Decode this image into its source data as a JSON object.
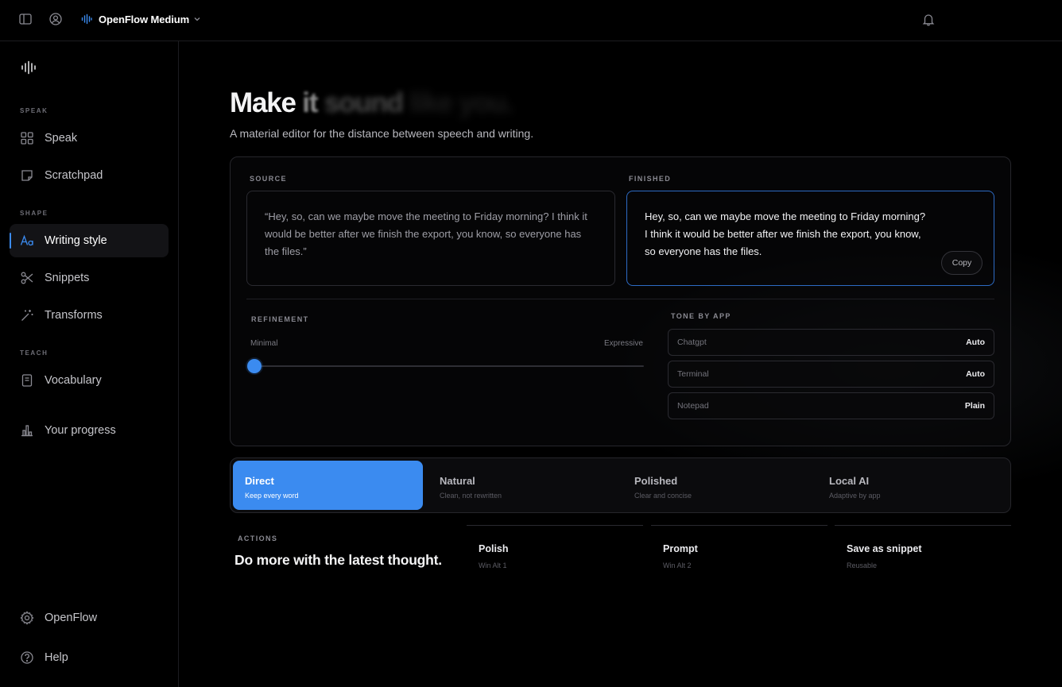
{
  "topbar": {
    "model_name": "OpenFlow Medium"
  },
  "sidebar": {
    "sections": {
      "speak": "SPEAK",
      "shape": "SHAPE",
      "teach": "TEACH"
    },
    "items": [
      {
        "label": "Speak",
        "icon": "grid-icon"
      },
      {
        "label": "Scratchpad",
        "icon": "note-icon"
      },
      {
        "label": "Writing style",
        "icon": "text-style-icon",
        "active": true
      },
      {
        "label": "Snippets",
        "icon": "scissors-icon"
      },
      {
        "label": "Transforms",
        "icon": "magic-wand-icon"
      },
      {
        "label": "Vocabulary",
        "icon": "book-icon"
      },
      {
        "label": "Your progress",
        "icon": "bar-chart-icon"
      }
    ],
    "footer": [
      {
        "label": "OpenFlow",
        "icon": "gear-icon"
      },
      {
        "label": "Help",
        "icon": "help-icon"
      }
    ]
  },
  "main": {
    "headline": {
      "w1": "Make",
      "w2": "it",
      "w3": "sound",
      "w4": "like you."
    },
    "subtitle": "A material editor for the distance between speech and writing.",
    "source": {
      "label": "SOURCE",
      "text": "“Hey, so, can we maybe move the meeting to Friday morning? I think it would be better after we finish the export, you know, so everyone has the files.”"
    },
    "finished": {
      "label": "FINISHED",
      "text": "Hey, so, can we maybe move the meeting to Friday morning? I think it would be better after we finish the export, you know, so everyone has the files.",
      "copy_label": "Copy"
    },
    "refinement": {
      "label": "REFINEMENT",
      "min_label": "Minimal",
      "max_label": "Expressive",
      "value": 0
    },
    "tone_by_app": {
      "label": "TONE BY APP",
      "rows": [
        {
          "app": "Chatgpt",
          "value": "Auto"
        },
        {
          "app": "Terminal",
          "value": "Auto"
        },
        {
          "app": "Notepad",
          "value": "Plain"
        }
      ]
    },
    "modes": [
      {
        "title": "Direct",
        "desc": "Keep every word",
        "active": true
      },
      {
        "title": "Natural",
        "desc": "Clean, not rewritten"
      },
      {
        "title": "Polished",
        "desc": "Clear and concise"
      },
      {
        "title": "Local AI",
        "desc": "Adaptive by app"
      }
    ],
    "actions": {
      "label": "ACTIONS",
      "title": "Do more with the latest thought.",
      "items": [
        {
          "title": "Polish",
          "sub": "Win Alt 1"
        },
        {
          "title": "Prompt",
          "sub": "Win Alt 2"
        },
        {
          "title": "Save as snippet",
          "sub": "Reusable"
        }
      ]
    }
  },
  "colors": {
    "accent": "#3b8bf0",
    "background": "#000000",
    "panel_border": "#26262b"
  }
}
